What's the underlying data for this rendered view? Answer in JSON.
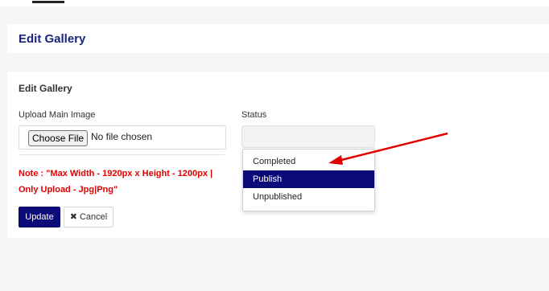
{
  "header": {
    "title": "Edit Gallery"
  },
  "form": {
    "section_title": "Edit Gallery",
    "upload_label": "Upload Main Image",
    "choose_file_label": "Choose File",
    "no_file_text": "No file chosen",
    "status_label": "Status",
    "note_text": "Note : \"Max Width - 1920px x Height - 1200px | Only Upload - Jpg|Png\"",
    "update_label": "Update",
    "cancel_label": "Cancel"
  },
  "status_dropdown": {
    "options": [
      "Completed",
      "Publish",
      "Unpublished"
    ],
    "highlighted": "Publish"
  },
  "colors": {
    "accent": "#0a0a78",
    "title": "#1a237e",
    "note": "#e00000",
    "arrow": "#e00000"
  }
}
